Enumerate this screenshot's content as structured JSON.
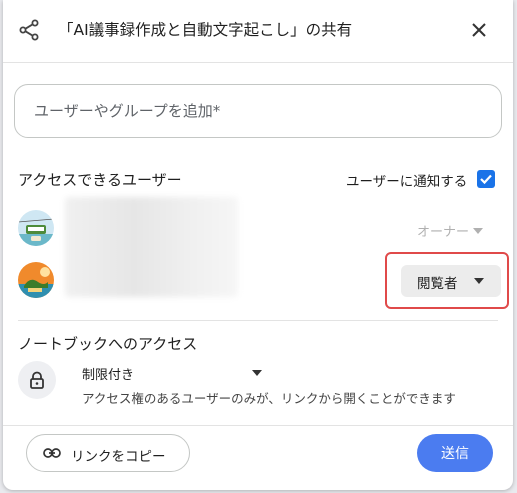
{
  "dialog": {
    "title": "「AI議事録作成と自動文字起こし」の共有",
    "share_icon": "share-icon",
    "close_icon": "close-icon"
  },
  "add_people": {
    "placeholder": "ユーザーやグループを追加*"
  },
  "access": {
    "heading": "アクセスできるユーザー",
    "notify_label": "ユーザーに通知する",
    "notify_checked": true,
    "owner_label": "オーナー",
    "role_label": "閲覧者"
  },
  "notebook_access": {
    "heading": "ノートブックへのアクセス",
    "mode": "制限付き",
    "description": "アクセス権のあるユーザーのみが、リンクから開くことができます",
    "lock_icon": "lock-icon"
  },
  "footer": {
    "copy_link_label": "リンクをコピー",
    "send_label": "送信"
  },
  "colors": {
    "accent": "#4b7cf0",
    "highlight": "#e04a4a"
  }
}
